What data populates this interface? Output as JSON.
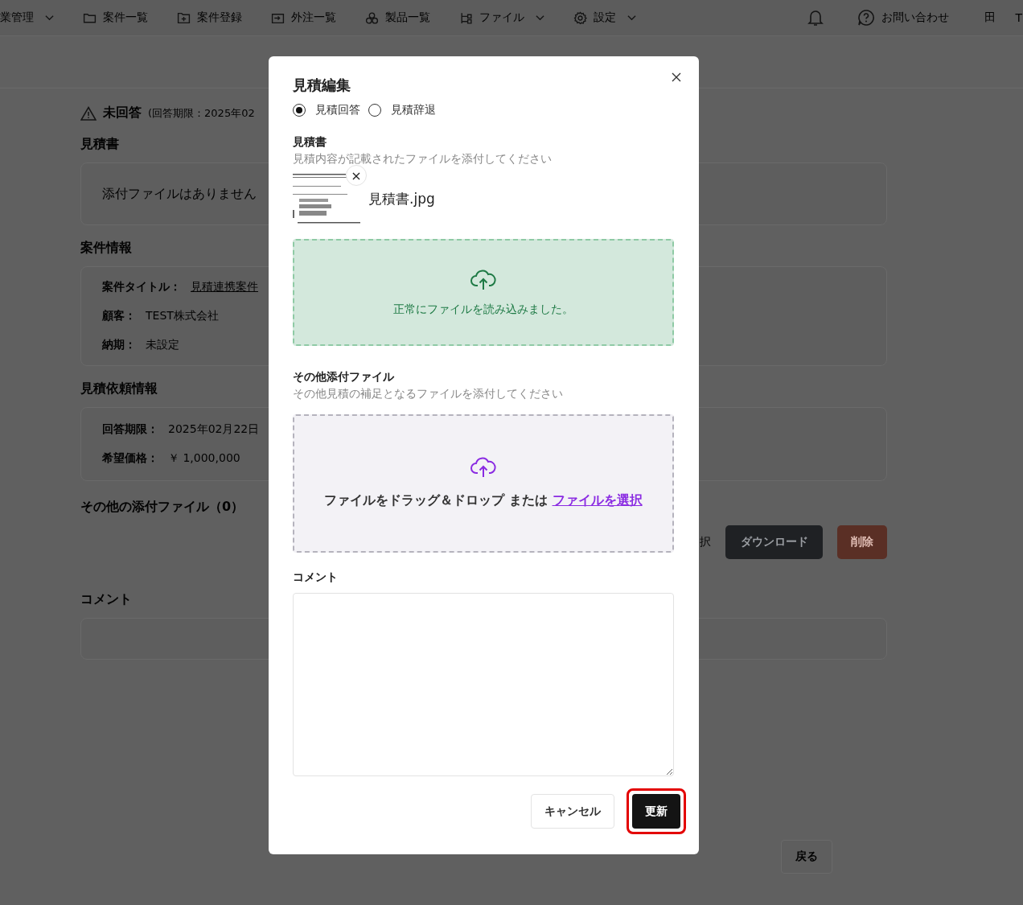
{
  "nav": {
    "items": [
      {
        "label": "業管理",
        "dropdown": true
      },
      {
        "label": "案件一覧",
        "dropdown": false
      },
      {
        "label": "案件登録",
        "dropdown": false
      },
      {
        "label": "外注一覧",
        "dropdown": false
      },
      {
        "label": "製品一覧",
        "dropdown": false
      },
      {
        "label": "ファイル",
        "dropdown": true
      },
      {
        "label": "設定",
        "dropdown": true
      }
    ],
    "help": "お問い合わせ",
    "extra": [
      "田",
      "T"
    ]
  },
  "status": {
    "label": "未回答",
    "deadline": "(回答期限：2025年02"
  },
  "quote": {
    "title": "見積書",
    "empty": "添付ファイルはありません"
  },
  "project": {
    "title": "案件情報",
    "fields": [
      {
        "label": "案件タイトル：",
        "value": "見積連携案件",
        "link": true
      },
      {
        "label": "顧客：",
        "value": "TEST株式会社",
        "link": false
      },
      {
        "label": "納期：",
        "value": "未設定",
        "link": false
      }
    ]
  },
  "request": {
    "title": "見積依頼情報",
    "fields": [
      {
        "label": "回答期限：",
        "value": "2025年02月22日",
        "link": false
      },
      {
        "label": "希望価格：",
        "value": "￥ 1,000,000",
        "link": false
      }
    ]
  },
  "attachments": {
    "title": "その他の添付ファイル（0）",
    "select_tail": "択",
    "buttons": [
      {
        "label": "ダウンロード",
        "kind": "dark"
      },
      {
        "label": "削除",
        "kind": "danger"
      }
    ]
  },
  "comment_section": {
    "title": "コメント"
  },
  "back": "戻る",
  "modal": {
    "title": "見積編集",
    "options": [
      {
        "label": "見積回答",
        "selected": true
      },
      {
        "label": "見積辞退",
        "selected": false
      }
    ],
    "quote_file": {
      "label": "見積書",
      "hint": "見積内容が記載されたファイルを添付してください",
      "file_name": "見積書.jpg",
      "remove": "×",
      "drop_status": "正常にファイルを読み込みました。"
    },
    "other_files": {
      "label": "その他添付ファイル",
      "hint": "その他見積の補足となるファイルを添付してください",
      "drop_text": "ファイルをドラッグ＆ドロップ または ",
      "select_link": "ファイルを選択"
    },
    "comment": {
      "label": "コメント"
    },
    "buttons": [
      {
        "label": "キャンセル",
        "kind": "secondary",
        "highlighted": false
      },
      {
        "label": "更新",
        "kind": "primary",
        "highlighted": true
      }
    ]
  }
}
